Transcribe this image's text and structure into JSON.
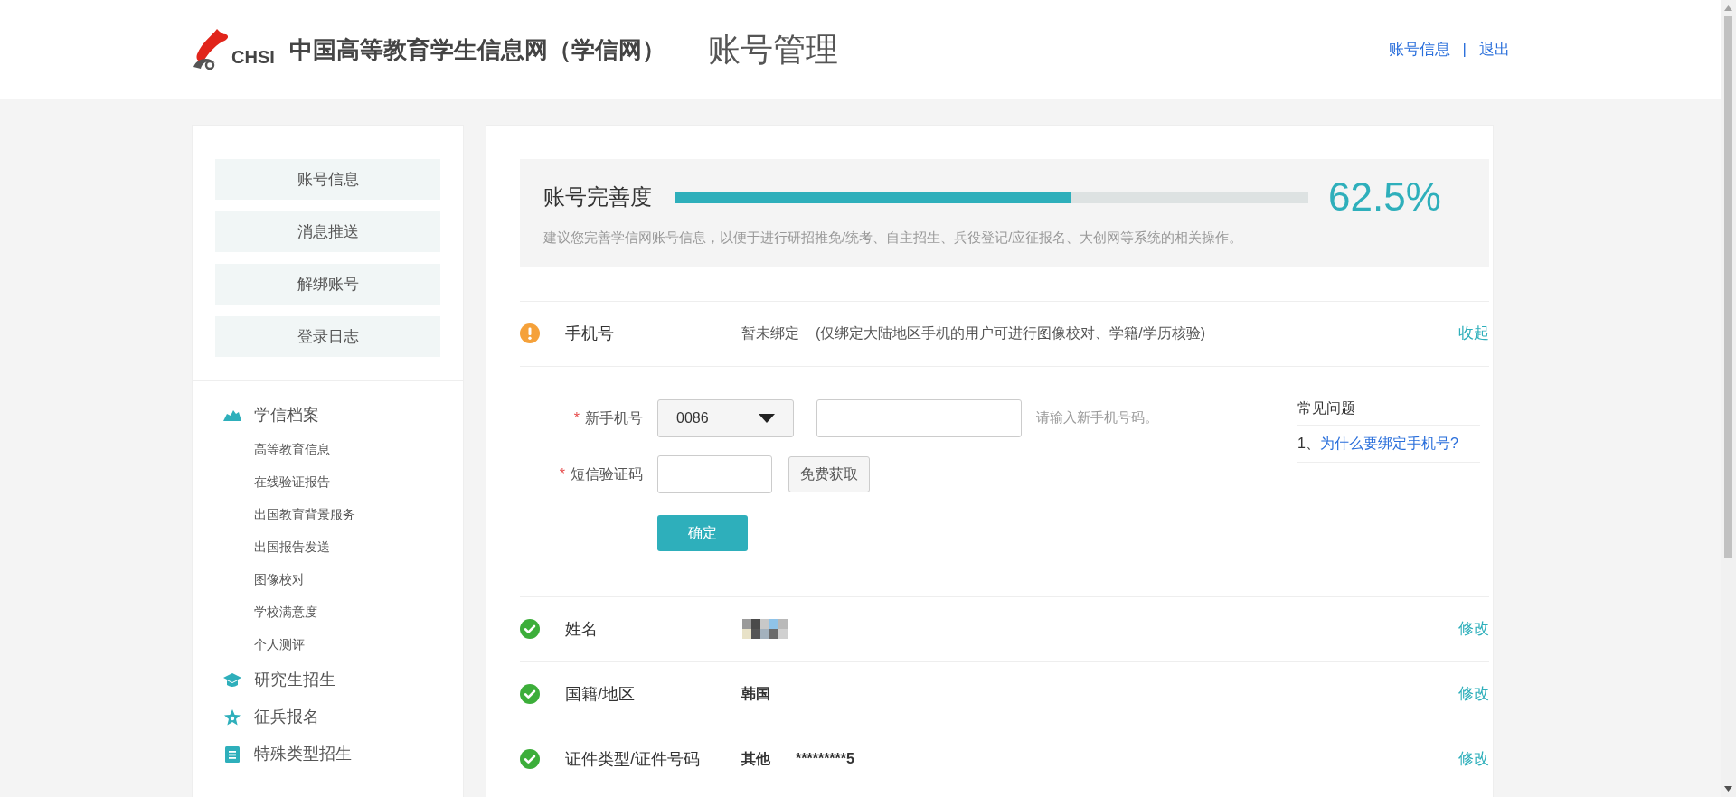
{
  "header": {
    "logo_text": "CHSI",
    "site_name": "中国高等教育学生信息网（学信网）",
    "page_title": "账号管理",
    "links": [
      "账号信息",
      "退出"
    ],
    "separator": "|"
  },
  "sidebar": {
    "account_menu": [
      "账号信息",
      "消息推送",
      "解绑账号",
      "登录日志"
    ],
    "sections": [
      {
        "title": "学信档案",
        "children": [
          "高等教育信息",
          "在线验证报告",
          "出国教育背景服务",
          "出国报告发送",
          "图像校对",
          "学校满意度",
          "个人测评"
        ]
      },
      {
        "title": "研究生招生"
      },
      {
        "title": "征兵报名"
      },
      {
        "title": "特殊类型招生"
      }
    ]
  },
  "completeness": {
    "title": "账号完善度",
    "level": 0.625,
    "percent": "62.5%",
    "hint": "建议您完善学信网账号信息，以便于进行研招推免/统考、自主招生、兵役登记/应征报名、大创网等系统的相关操作。"
  },
  "fields": [
    {
      "kind": "warning",
      "label": "手机号",
      "value": "暂未绑定",
      "note": "(仅绑定大陆地区手机的用户可进行图像校对、学籍/学历核验)",
      "action": "收起",
      "form": {
        "rows": [
          {
            "kind": "phone",
            "required_mark": "*",
            "label": "新手机号",
            "country_code": "0086",
            "hint": "请输入新手机号码。"
          },
          {
            "kind": "sms",
            "required_mark": "*",
            "label": "短信验证码",
            "button": "免费获取"
          }
        ],
        "submit": "确定",
        "faq": {
          "title": "常见问题",
          "items": [
            {
              "number": "1、",
              "question": "为什么要绑定手机号?"
            }
          ]
        }
      }
    },
    {
      "kind": "ok",
      "label": "姓名",
      "action": "修改"
    },
    {
      "kind": "ok",
      "label": "国籍/地区",
      "value": "韩国",
      "action": "修改"
    },
    {
      "kind": "ok",
      "label": "证件类型/证件号码",
      "value": "其他",
      "note": "*********5",
      "action": "修改"
    }
  ]
}
